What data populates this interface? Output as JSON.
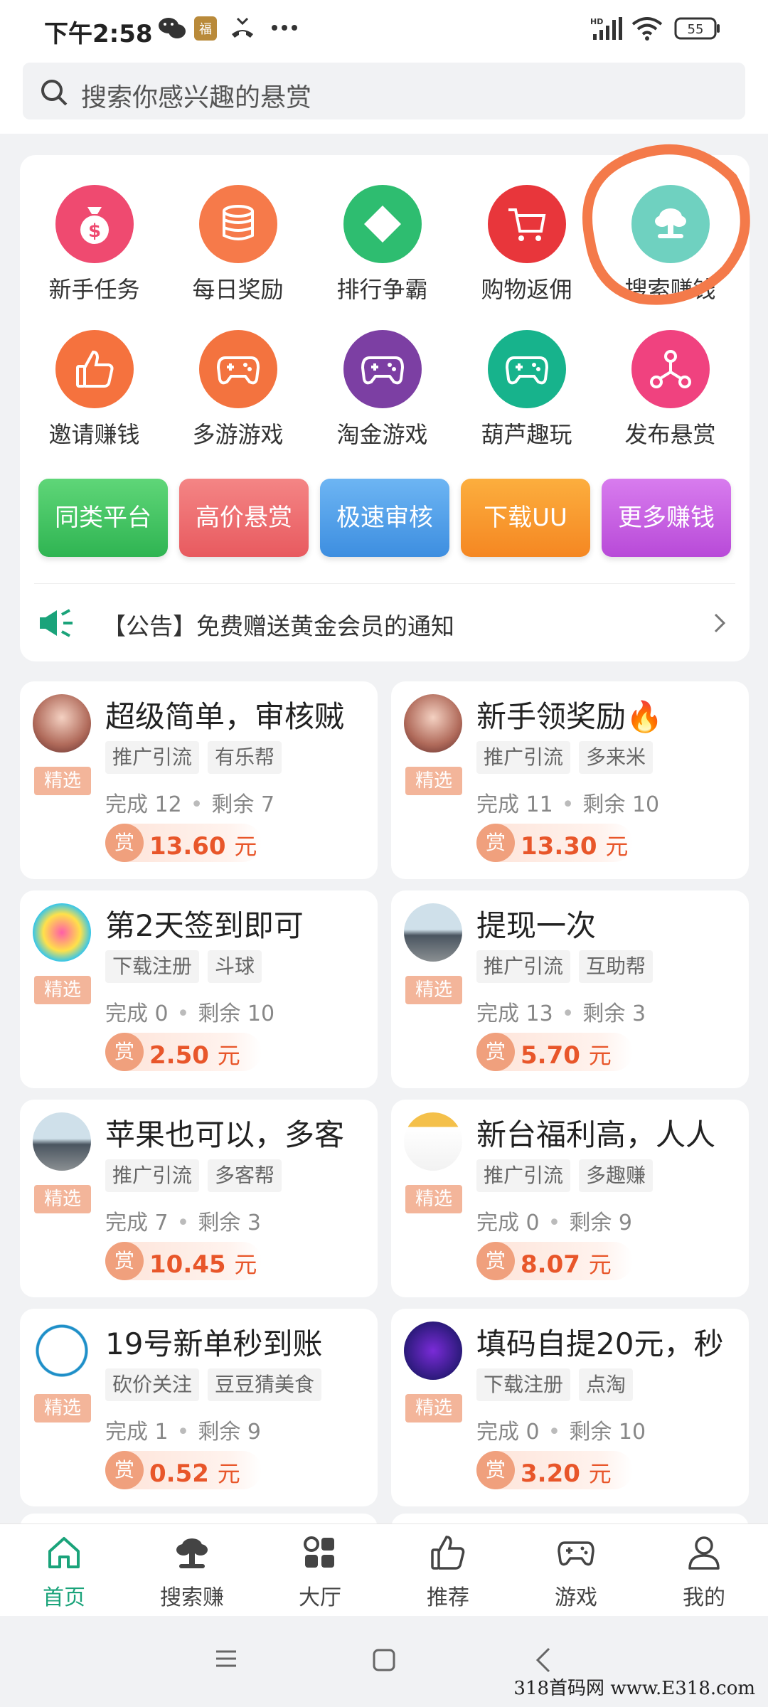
{
  "status_bar": {
    "time": "下午2:58",
    "network": "HD",
    "battery": "55"
  },
  "search": {
    "placeholder": "搜索你感兴趣的悬赏"
  },
  "quick_menu": [
    {
      "label": "新手任务",
      "icon": "money-bag-icon",
      "color": "#ef4a70"
    },
    {
      "label": "每日奖励",
      "icon": "coins-icon",
      "color": "#f67a4a"
    },
    {
      "label": "排行争霸",
      "icon": "diamond-icon",
      "color": "#2ebd70"
    },
    {
      "label": "购物返佣",
      "icon": "cart-icon",
      "color": "#e8363b"
    },
    {
      "label": "搜索赚钱",
      "icon": "search-earn-icon",
      "color": "#6fd1c0"
    },
    {
      "label": "邀请赚钱",
      "icon": "thumbs-up-icon",
      "color": "#f5723e"
    },
    {
      "label": "多游游戏",
      "icon": "gamepad-icon",
      "color": "#f3733f"
    },
    {
      "label": "淘金游戏",
      "icon": "gamepad-icon",
      "color": "#7c3fa3"
    },
    {
      "label": "葫芦趣玩",
      "icon": "gamepad-icon",
      "color": "#17b38c"
    },
    {
      "label": "发布悬赏",
      "icon": "share-nodes-icon",
      "color": "#f0427f"
    }
  ],
  "pills": [
    {
      "label": "同类平台",
      "color": "#3cc35d"
    },
    {
      "label": "高价悬赏",
      "color": "#ef6a6a"
    },
    {
      "label": "极速审核",
      "color": "#4a9be8"
    },
    {
      "label": "下载UU",
      "color": "#f7962a"
    },
    {
      "label": "更多赚钱",
      "color": "#c45ee0"
    }
  ],
  "notice": {
    "text": "【公告】免费赠送黄金会员的通知"
  },
  "labels": {
    "selected": "精选",
    "reward_icon": "赏",
    "unit": "元"
  },
  "tasks": [
    {
      "title": "超级简单，审核贼",
      "tags": [
        "推广引流",
        "有乐帮"
      ],
      "done": "完成 12",
      "left": "剩余 7",
      "amount": "13.60"
    },
    {
      "title": "新手领奖励🔥",
      "tags": [
        "推广引流",
        "多来米"
      ],
      "done": "完成 11",
      "left": "剩余 10",
      "amount": "13.30"
    },
    {
      "title": "第2天签到即可",
      "tags": [
        "下载注册",
        "斗球"
      ],
      "done": "完成 0",
      "left": "剩余 10",
      "amount": "2.50"
    },
    {
      "title": "提现一次",
      "tags": [
        "推广引流",
        "互助帮"
      ],
      "done": "完成 13",
      "left": "剩余 3",
      "amount": "5.70"
    },
    {
      "title": "苹果也可以，多客",
      "tags": [
        "推广引流",
        "多客帮"
      ],
      "done": "完成 7",
      "left": "剩余 3",
      "amount": "10.45"
    },
    {
      "title": "新台福利高，人人",
      "tags": [
        "推广引流",
        "多趣赚"
      ],
      "done": "完成 0",
      "left": "剩余 9",
      "amount": "8.07"
    },
    {
      "title": "19号新单秒到账",
      "tags": [
        "砍价关注",
        "豆豆猜美食"
      ],
      "done": "完成 1",
      "left": "剩余 9",
      "amount": "0.52"
    },
    {
      "title": "填码自提20元，秒",
      "tags": [
        "下载注册",
        "点淘"
      ],
      "done": "完成 0",
      "left": "剩余 10",
      "amount": "3.20"
    }
  ],
  "bottom_nav": [
    {
      "label": "首页",
      "icon": "home-icon",
      "active": true
    },
    {
      "label": "搜索赚",
      "icon": "search-earn-icon",
      "active": false
    },
    {
      "label": "大厅",
      "icon": "hall-icon",
      "active": false
    },
    {
      "label": "推荐",
      "icon": "thumbs-up-icon",
      "active": false
    },
    {
      "label": "游戏",
      "icon": "gamepad-icon",
      "active": false
    },
    {
      "label": "我的",
      "icon": "user-icon",
      "active": false
    }
  ],
  "colors": {
    "accent": "#1aa37a",
    "highlight_circle": "#f47a4a",
    "reward": "#e8562a"
  },
  "watermark": "318首码网 www.E318.com"
}
